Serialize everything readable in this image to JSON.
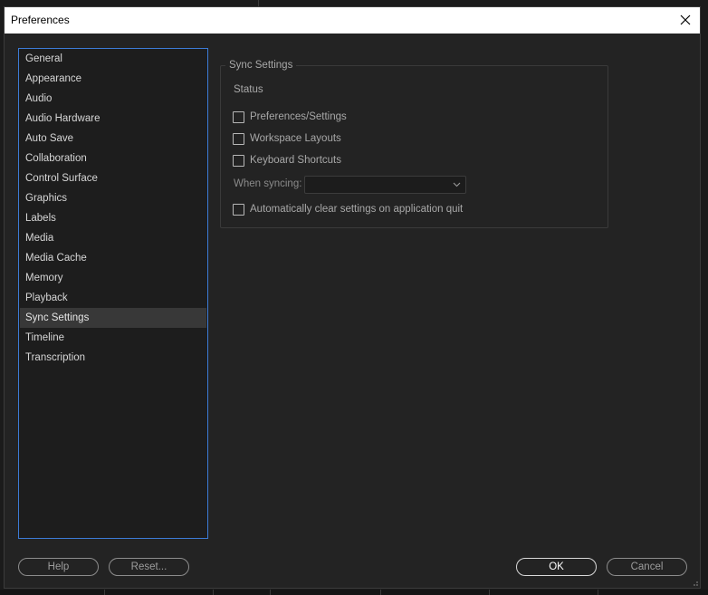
{
  "window": {
    "title": "Preferences"
  },
  "sidebar": {
    "items": [
      {
        "label": "General"
      },
      {
        "label": "Appearance"
      },
      {
        "label": "Audio"
      },
      {
        "label": "Audio Hardware"
      },
      {
        "label": "Auto Save"
      },
      {
        "label": "Collaboration"
      },
      {
        "label": "Control Surface"
      },
      {
        "label": "Graphics"
      },
      {
        "label": "Labels"
      },
      {
        "label": "Media"
      },
      {
        "label": "Media Cache"
      },
      {
        "label": "Memory"
      },
      {
        "label": "Playback"
      },
      {
        "label": "Sync Settings"
      },
      {
        "label": "Timeline"
      },
      {
        "label": "Transcription"
      }
    ],
    "selected_label": "Sync Settings"
  },
  "sync_settings": {
    "group_title": "Sync Settings",
    "status_label": "Status",
    "options": [
      {
        "label": "Preferences/Settings",
        "checked": false
      },
      {
        "label": "Workspace Layouts",
        "checked": false
      },
      {
        "label": "Keyboard Shortcuts",
        "checked": false
      }
    ],
    "when_syncing_label": "When syncing:",
    "when_syncing_value": "",
    "auto_clear": {
      "label": "Automatically clear settings on application quit",
      "checked": false
    }
  },
  "footer": {
    "help_label": "Help",
    "reset_label": "Reset...",
    "ok_label": "OK",
    "cancel_label": "Cancel"
  },
  "colors": {
    "dialog_bg": "#232323",
    "titlebar_bg": "#ffffff",
    "list_focus_border": "#3c7bd6",
    "selected_item_bg": "#383838"
  },
  "icons": {
    "close": "close-icon",
    "dropdown": "chevron-down-icon",
    "resize": "resize-grip-icon"
  }
}
